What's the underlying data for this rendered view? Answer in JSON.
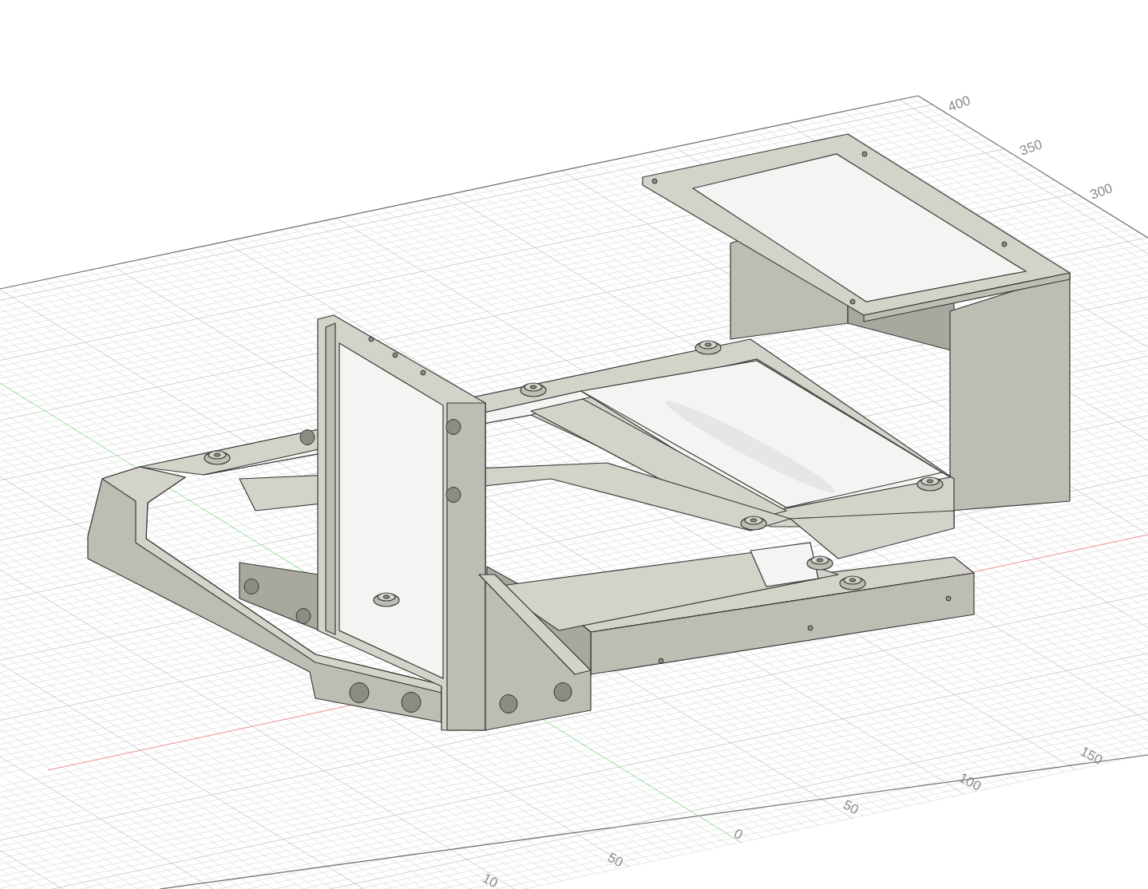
{
  "viewport": {
    "grid_labels": {
      "far_edge": [
        "400",
        "350",
        "300"
      ],
      "near_edge": [
        "150",
        "100",
        "50",
        "0",
        "50",
        "10"
      ]
    }
  }
}
